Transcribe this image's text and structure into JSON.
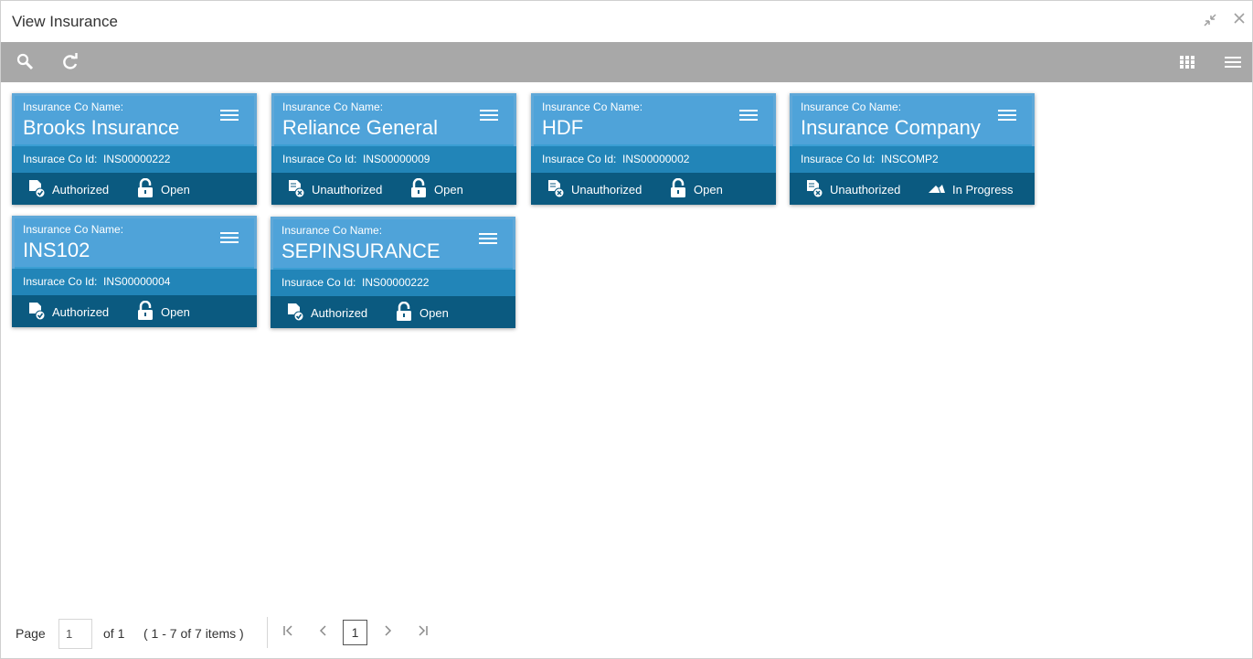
{
  "window": {
    "title": "View Insurance"
  },
  "labels": {
    "name_label": "Insurance Co Name:",
    "id_label": "Insurace Co Id:"
  },
  "cards": [
    {
      "name": "Brooks Insurance",
      "id": "INS00000222",
      "auth": "Authorized",
      "status": "Open"
    },
    {
      "name": "Reliance General",
      "id": "INS00000009",
      "auth": "Unauthorized",
      "status": "Open"
    },
    {
      "name": "HDF",
      "id": "INS00000002",
      "auth": "Unauthorized",
      "status": "Open"
    },
    {
      "name": "Insurance Company",
      "id": "INSCOMP2",
      "auth": "Unauthorized",
      "status": "In Progress"
    },
    {
      "name": "INS102",
      "id": "INS00000004",
      "auth": "Authorized",
      "status": "Open"
    },
    {
      "name": "SEPINSURANCE",
      "id": "INS00000222",
      "auth": "Authorized",
      "status": "Open"
    }
  ],
  "pager": {
    "page_label": "Page",
    "page_value": "1",
    "of_label": "of 1",
    "range_label": "( 1 - 7 of 7 items )",
    "current_page": "1"
  },
  "colors": {
    "toolbar": "#a8a8a8",
    "card_head": "#4fa3d9",
    "card_id_band": "#2285b8",
    "card_footer": "#0b5a80"
  }
}
